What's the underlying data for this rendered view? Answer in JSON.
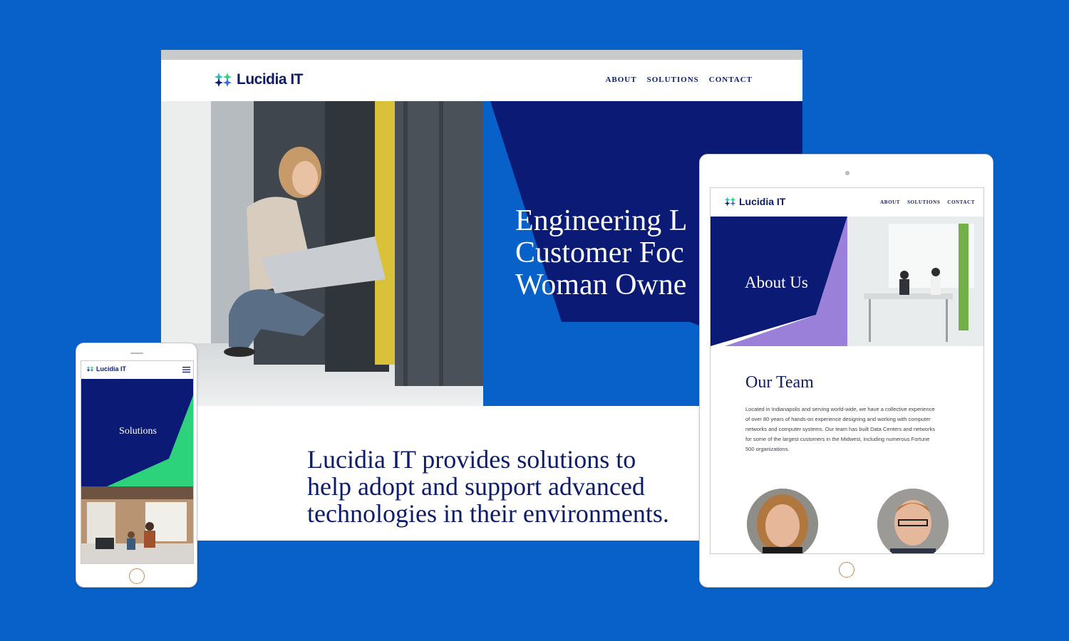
{
  "brand": {
    "name": "Lucidia IT"
  },
  "nav": {
    "about": "ABOUT",
    "solutions": "SOLUTIONS",
    "contact": "CONTACT"
  },
  "desktop": {
    "hero_title": "Engineering L\nCustomer Foc\nWoman Owne",
    "body_text": "Lucidia IT provides solutions to help adopt and support advanced technologies in their environments."
  },
  "tablet": {
    "hero_title": "About Us",
    "section_title": "Our Team",
    "section_text": "Located in Indianapolis and serving world-wide, we have a collective experience of over 80 years of hands-on experience designing and working with computer networks and computer systems. Our team has built Data Centers and networks for some of the largest customers in the Midwest, including numerous Fortune 500 organizations."
  },
  "phone": {
    "hero_title": "Solutions"
  },
  "colors": {
    "background": "#0761c9",
    "navy": "#0c1b6b",
    "purple": "#9b80d9",
    "green": "#2dd37a"
  },
  "icons": [
    "lucidia-star-logo-icon",
    "hamburger-menu-icon"
  ]
}
